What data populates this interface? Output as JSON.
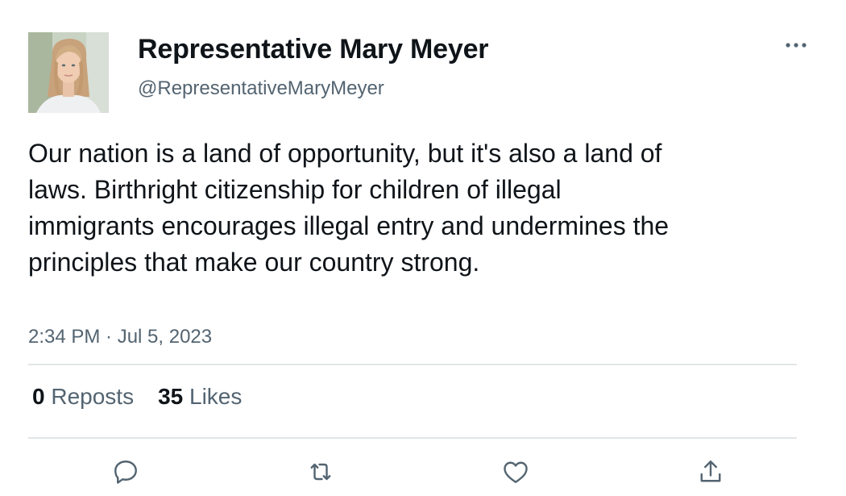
{
  "author": {
    "name": "Representative Mary Meyer",
    "handle": "@RepresentativeMaryMeyer"
  },
  "tweet": {
    "text": "Our nation is a land of opportunity, but it's also a land of laws. Birthright citizenship for children of illegal immigrants encourages illegal entry and undermines the principles that make our country strong.",
    "timestamp": "2:34 PM · Jul 5, 2023"
  },
  "stats": {
    "reposts_count": "0",
    "reposts_label": "Reposts",
    "likes_count": "35",
    "likes_label": "Likes"
  },
  "icons": {
    "more": "more-horizontal-icon",
    "reply": "reply-icon",
    "repost": "repost-icon",
    "like": "heart-icon",
    "share": "share-icon"
  },
  "colors": {
    "text": "#0f1419",
    "secondary": "#536471",
    "divider": "#e3e6e8"
  }
}
